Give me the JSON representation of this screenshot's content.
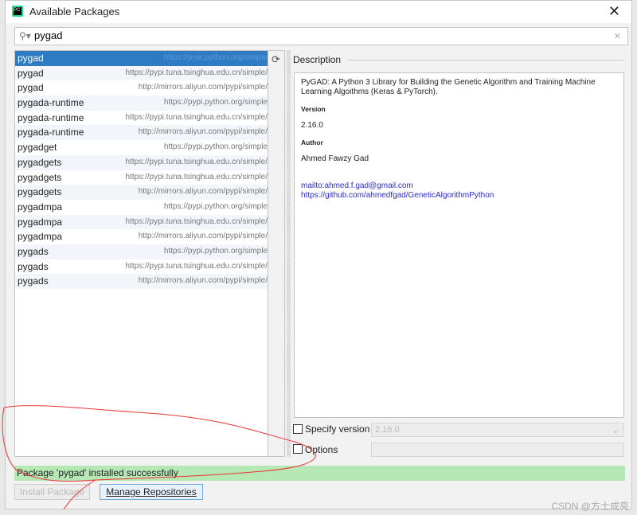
{
  "window": {
    "title": "Available Packages",
    "close": "✕"
  },
  "search": {
    "value": "pygad",
    "icon": "search-icon"
  },
  "packages": [
    {
      "name": "pygad",
      "repo": "https://pypi.python.org/simple"
    },
    {
      "name": "pygad",
      "repo": "https://pypi.tuna.tsinghua.edu.cn/simple/"
    },
    {
      "name": "pygad",
      "repo": "http://mirrors.aliyun.com/pypi/simple/"
    },
    {
      "name": "pygada-runtime",
      "repo": "https://pypi.python.org/simple"
    },
    {
      "name": "pygada-runtime",
      "repo": "https://pypi.tuna.tsinghua.edu.cn/simple/"
    },
    {
      "name": "pygada-runtime",
      "repo": "http://mirrors.aliyun.com/pypi/simple/"
    },
    {
      "name": "pygadget",
      "repo": "https://pypi.python.org/simple"
    },
    {
      "name": "pygadgets",
      "repo": "https://pypi.tuna.tsinghua.edu.cn/simple/"
    },
    {
      "name": "pygadgets",
      "repo": "https://pypi.tuna.tsinghua.edu.cn/simple/"
    },
    {
      "name": "pygadgets",
      "repo": "http://mirrors.aliyun.com/pypi/simple/"
    },
    {
      "name": "pygadmpa",
      "repo": "https://pypi.python.org/simple"
    },
    {
      "name": "pygadmpa",
      "repo": "https://pypi.tuna.tsinghua.edu.cn/simple/"
    },
    {
      "name": "pygadmpa",
      "repo": "http://mirrors.aliyun.com/pypi/simple/"
    },
    {
      "name": "pygads",
      "repo": "https://pypi.python.org/simple"
    },
    {
      "name": "pygads",
      "repo": "https://pypi.tuna.tsinghua.edu.cn/simple/"
    },
    {
      "name": "pygads",
      "repo": "http://mirrors.aliyun.com/pypi/simple/"
    }
  ],
  "description": {
    "header": "Description",
    "summary": "PyGAD: A Python 3 Library for Building the Genetic Algorithm and Training Machine Learning Algoithms (Keras & PyTorch).",
    "version_label": "Version",
    "version": "2.16.0",
    "author_label": "Author",
    "author": "Ahmed Fawzy Gad",
    "email_link": "mailto:ahmed.f.gad@gmail.com",
    "home_link": "https://github.com/ahmedfgad/GeneticAlgorithmPython"
  },
  "options": {
    "specify_version_label": "Specify version",
    "specify_version_value": "2.16.0",
    "options_label": "Options"
  },
  "status": "Package 'pygad' installed successfully",
  "buttons": {
    "install": "Install Package",
    "manage": "Manage Repositories"
  },
  "watermark": "CSDN @方士成亮",
  "colors": {
    "selection": "#2f7bc3",
    "status_bg": "#b6e8b6",
    "link": "#2a2ad0"
  }
}
